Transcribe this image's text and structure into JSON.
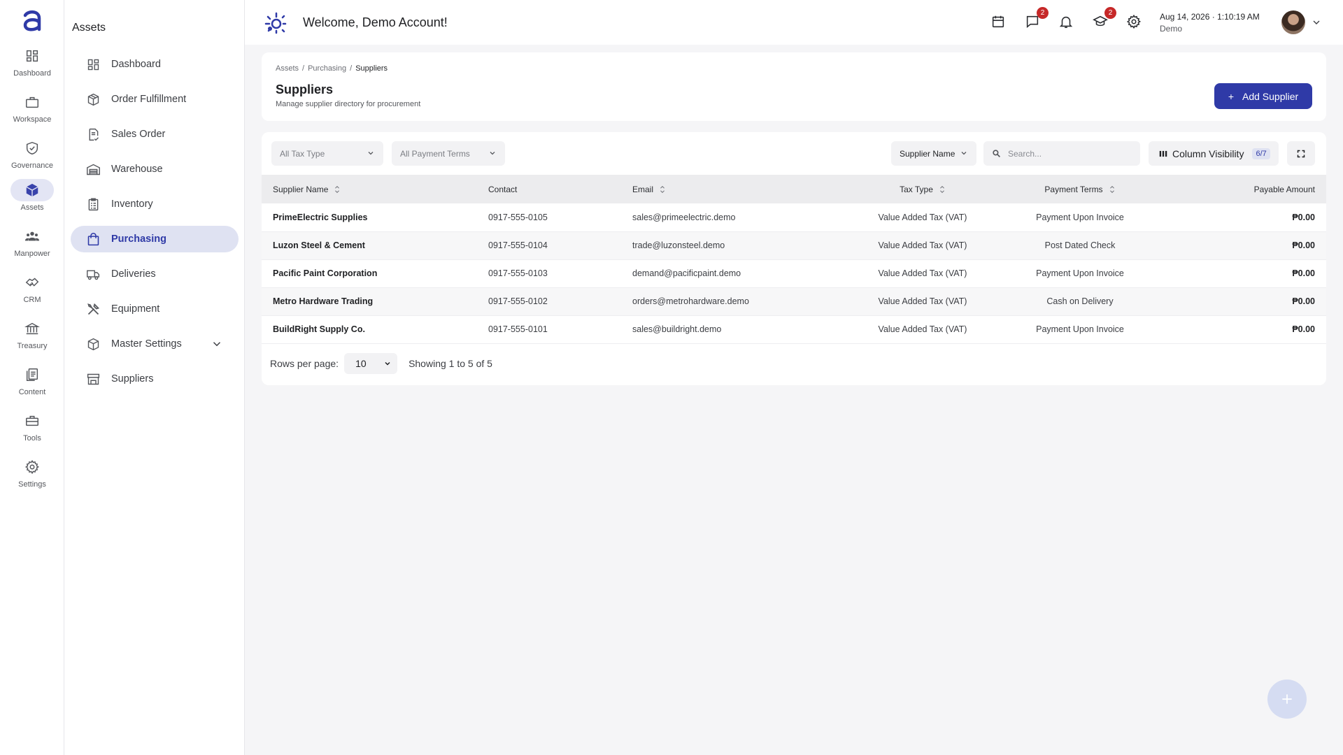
{
  "rail": {
    "items": [
      {
        "label": "Dashboard",
        "icon": "dashboard-icon"
      },
      {
        "label": "Workspace",
        "icon": "briefcase-icon"
      },
      {
        "label": "Governance",
        "icon": "shield-check-icon"
      },
      {
        "label": "Assets",
        "icon": "cube-icon",
        "active": true
      },
      {
        "label": "Manpower",
        "icon": "people-icon"
      },
      {
        "label": "CRM",
        "icon": "handshake-icon"
      },
      {
        "label": "Treasury",
        "icon": "bank-icon"
      },
      {
        "label": "Content",
        "icon": "documents-icon"
      },
      {
        "label": "Tools",
        "icon": "toolbox-icon"
      },
      {
        "label": "Settings",
        "icon": "gear-icon"
      }
    ]
  },
  "sidebar": {
    "title": "Assets",
    "items": [
      {
        "label": "Dashboard",
        "icon": "dashboard-icon"
      },
      {
        "label": "Order Fulfillment",
        "icon": "package-icon"
      },
      {
        "label": "Sales Order",
        "icon": "document-check-icon"
      },
      {
        "label": "Warehouse",
        "icon": "warehouse-icon"
      },
      {
        "label": "Inventory",
        "icon": "clipboard-icon"
      },
      {
        "label": "Purchasing",
        "icon": "shopping-bag-icon",
        "active": true
      },
      {
        "label": "Deliveries",
        "icon": "truck-icon"
      },
      {
        "label": "Equipment",
        "icon": "tools-icon"
      },
      {
        "label": "Master Settings",
        "icon": "cube-outline-icon"
      },
      {
        "label": "Suppliers",
        "icon": "store-icon"
      }
    ]
  },
  "header": {
    "welcome": "Welcome, Demo Account!",
    "messages_badge": "2",
    "learning_badge": "2",
    "date": "Aug 14, 2026",
    "time": "1:10:19 AM",
    "date_sep": "·",
    "user": "Demo"
  },
  "page": {
    "breadcrumbs": [
      "Assets",
      "Purchasing",
      "Suppliers"
    ],
    "breadcrumb_sep": "/",
    "title": "Suppliers",
    "description": "Manage supplier directory for procurement",
    "add_button": "Add Supplier"
  },
  "filters": {
    "tax_type": "All Tax Type",
    "payment_terms": "All Payment Terms",
    "sort_field": "Supplier Name",
    "search_placeholder": "Search...",
    "column_visibility": "Column Visibility",
    "column_visibility_count": "6/7"
  },
  "table": {
    "columns": [
      "Supplier Name",
      "Contact",
      "Email",
      "Tax Type",
      "Payment Terms",
      "Payable Amount"
    ],
    "rows": [
      {
        "name": "PrimeElectric Supplies",
        "contact": "0917-555-0105",
        "email": "sales@primeelectric.demo",
        "tax": "Value Added Tax (VAT)",
        "terms": "Payment Upon Invoice",
        "amount": "₱0.00"
      },
      {
        "name": "Luzon Steel & Cement",
        "contact": "0917-555-0104",
        "email": "trade@luzonsteel.demo",
        "tax": "Value Added Tax (VAT)",
        "terms": "Post Dated Check",
        "amount": "₱0.00"
      },
      {
        "name": "Pacific Paint Corporation",
        "contact": "0917-555-0103",
        "email": "demand@pacificpaint.demo",
        "tax": "Value Added Tax (VAT)",
        "terms": "Payment Upon Invoice",
        "amount": "₱0.00"
      },
      {
        "name": "Metro Hardware Trading",
        "contact": "0917-555-0102",
        "email": "orders@metrohardware.demo",
        "tax": "Value Added Tax (VAT)",
        "terms": "Cash on Delivery",
        "amount": "₱0.00"
      },
      {
        "name": "BuildRight Supply Co.",
        "contact": "0917-555-0101",
        "email": "sales@buildright.demo",
        "tax": "Value Added Tax (VAT)",
        "terms": "Payment Upon Invoice",
        "amount": "₱0.00"
      }
    ]
  },
  "pagination": {
    "rows_per_page_label": "Rows per page:",
    "rows_per_page": "10",
    "showing": "Showing 1 to 5 of 5"
  },
  "colors": {
    "accent": "#2f3aa7",
    "accent_light": "#dfe2f2",
    "badge": "#c62828"
  }
}
